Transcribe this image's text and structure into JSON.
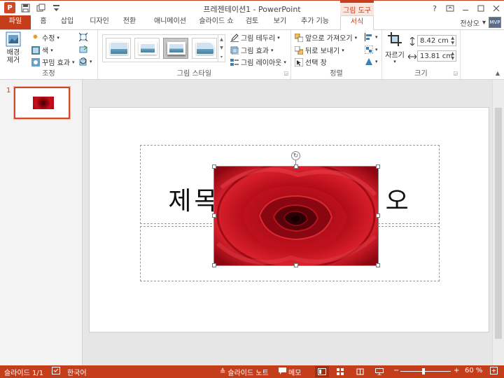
{
  "window": {
    "title": "프레젠테이션1 - PowerPoint",
    "context_tools_label": "그림 도구",
    "help": "?",
    "icons": [
      "powerpoint-logo",
      "save-icon",
      "undo-icon",
      "customize-qat-icon",
      "ribbon-display-icon",
      "minimize-icon",
      "maximize-icon",
      "close-icon"
    ]
  },
  "tabs": {
    "file": "파일",
    "home": "홈",
    "insert": "삽입",
    "design": "디자인",
    "transitions": "전환",
    "animations": "애니메이션",
    "slideshow": "슬라이드 쇼",
    "review": "검토",
    "view": "보기",
    "addins": "추가 기능",
    "format": "서식"
  },
  "user": {
    "name": "전상오",
    "avatar_text": "MVP"
  },
  "ribbon": {
    "adjust": {
      "label": "조정",
      "remove_bg": "배경\n제거",
      "corrections": "수정",
      "color": "색",
      "artistic": "꾸밈 효과"
    },
    "styles": {
      "label": "그림 스타일",
      "border": "그림 테두리",
      "effects": "그림 효과",
      "layout": "그림 레이아웃",
      "selected_index": 2
    },
    "arrange": {
      "label": "정렬",
      "bring_forward": "앞으로 가져오기",
      "send_backward": "뒤로 보내기",
      "selection_pane": "선택 창"
    },
    "size": {
      "label": "크기",
      "crop": "자르기",
      "height": "8.42 cm",
      "width": "13.81 cm"
    }
  },
  "slides_pane": {
    "slide_number": "1"
  },
  "slide": {
    "title_text": "제목을 추가하려면 클릭하십시오",
    "title_visible_left": "제목",
    "title_visible_right": "오"
  },
  "status": {
    "slide_info": "슬라이드 1/1",
    "language": "한국어",
    "notes": "슬라이드 노트",
    "comments": "메모",
    "zoom": "60 %",
    "zoom_minus": "−",
    "zoom_plus": "+"
  },
  "colors": {
    "accent": "#c43e1c",
    "rose_dark": "#3a0004",
    "rose_mid": "#a5000d",
    "rose_light": "#e0202d"
  }
}
